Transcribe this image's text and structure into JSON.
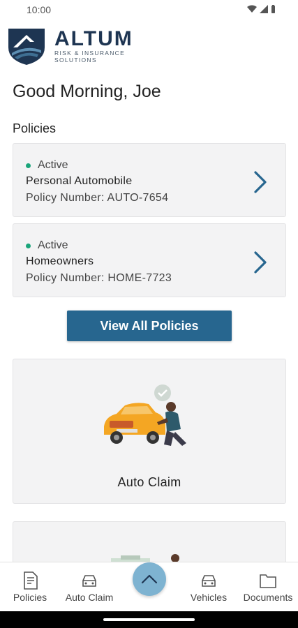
{
  "status_bar": {
    "time": "10:00",
    "icons": [
      "wifi-icon",
      "signal-icon",
      "battery-icon"
    ]
  },
  "brand": {
    "name": "ALTUM",
    "tagline": "RISK & INSURANCE SOLUTIONS",
    "colors": {
      "navy": "#1e3552",
      "accent": "#27668f",
      "active": "#1aa57a"
    }
  },
  "greeting": "Good Morning, Joe",
  "policies": {
    "title": "Policies",
    "items": [
      {
        "status": "Active",
        "name": "Personal Automobile",
        "number": "Policy Number: AUTO-7654"
      },
      {
        "status": "Active",
        "name": "Homeowners",
        "number": "Policy Number: HOME-7723"
      }
    ],
    "view_all_label": "View All Policies"
  },
  "claim_card": {
    "label": "Auto Claim",
    "illustration": "car-repair-illustration"
  },
  "bottom_nav": {
    "items": [
      {
        "label": "Policies",
        "icon": "document-icon"
      },
      {
        "label": "Auto Claim",
        "icon": "car-icon"
      },
      {
        "label": "Vehicles",
        "icon": "car-icon"
      },
      {
        "label": "Documents",
        "icon": "folder-icon"
      }
    ],
    "fab_icon": "chevron-up-icon"
  }
}
